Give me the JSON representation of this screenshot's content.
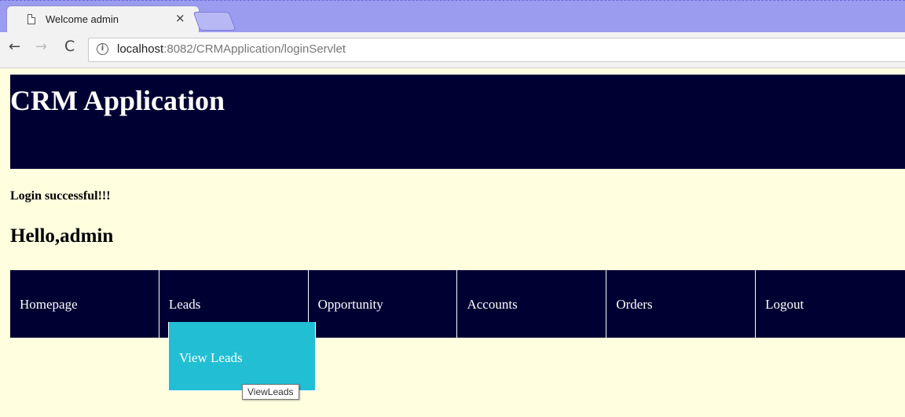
{
  "browser": {
    "tab_title": "Welcome admin",
    "close_glyph": "×",
    "url_host": "localhost",
    "url_path": ":8082/CRMApplication/loginServlet",
    "back_glyph": "←",
    "forward_glyph": "→",
    "reload_glyph": "C",
    "info_glyph": "i"
  },
  "header": {
    "title": "CRM Application"
  },
  "messages": {
    "login": "Login successful!!!",
    "greeting": "Hello,admin"
  },
  "nav": {
    "items": [
      {
        "label": "Homepage"
      },
      {
        "label": "Leads"
      },
      {
        "label": "Opportunity"
      },
      {
        "label": "Accounts"
      },
      {
        "label": "Orders"
      },
      {
        "label": "Logout"
      }
    ]
  },
  "dropdown": {
    "item": "View Leads"
  },
  "tooltip": {
    "text": "ViewLeads"
  },
  "colors": {
    "page_bg": "#ffffe0",
    "banner_bg": "#000033",
    "dropdown_bg": "#22bfd4",
    "tabstrip_bg": "#9b9bef"
  }
}
